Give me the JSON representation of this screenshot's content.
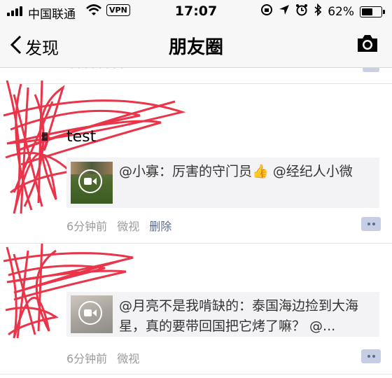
{
  "status_bar": {
    "carrier": "中国联通",
    "vpn": "VPN",
    "time": "17:07",
    "battery": "62%",
    "battery_level": 0.62
  },
  "nav": {
    "back_label": "发现",
    "title": "朋友圈",
    "camera_icon": "camera-icon"
  },
  "posts": [
    {
      "text": "test",
      "share_text": "@小寡：厉害的守门员👍 @经纪人小微",
      "time": "6分钟前",
      "source": "微视",
      "delete_label": "删除"
    },
    {
      "share_text": "@月亮不是我啃缺的：泰国海边捡到大海星，真的要带回国把它烤了嘛？ @...",
      "time": "6分钟前",
      "source": "微视"
    }
  ],
  "colors": {
    "link": "#5b6a91",
    "meta": "#9b9b9b",
    "redaction": "#e8233a"
  }
}
